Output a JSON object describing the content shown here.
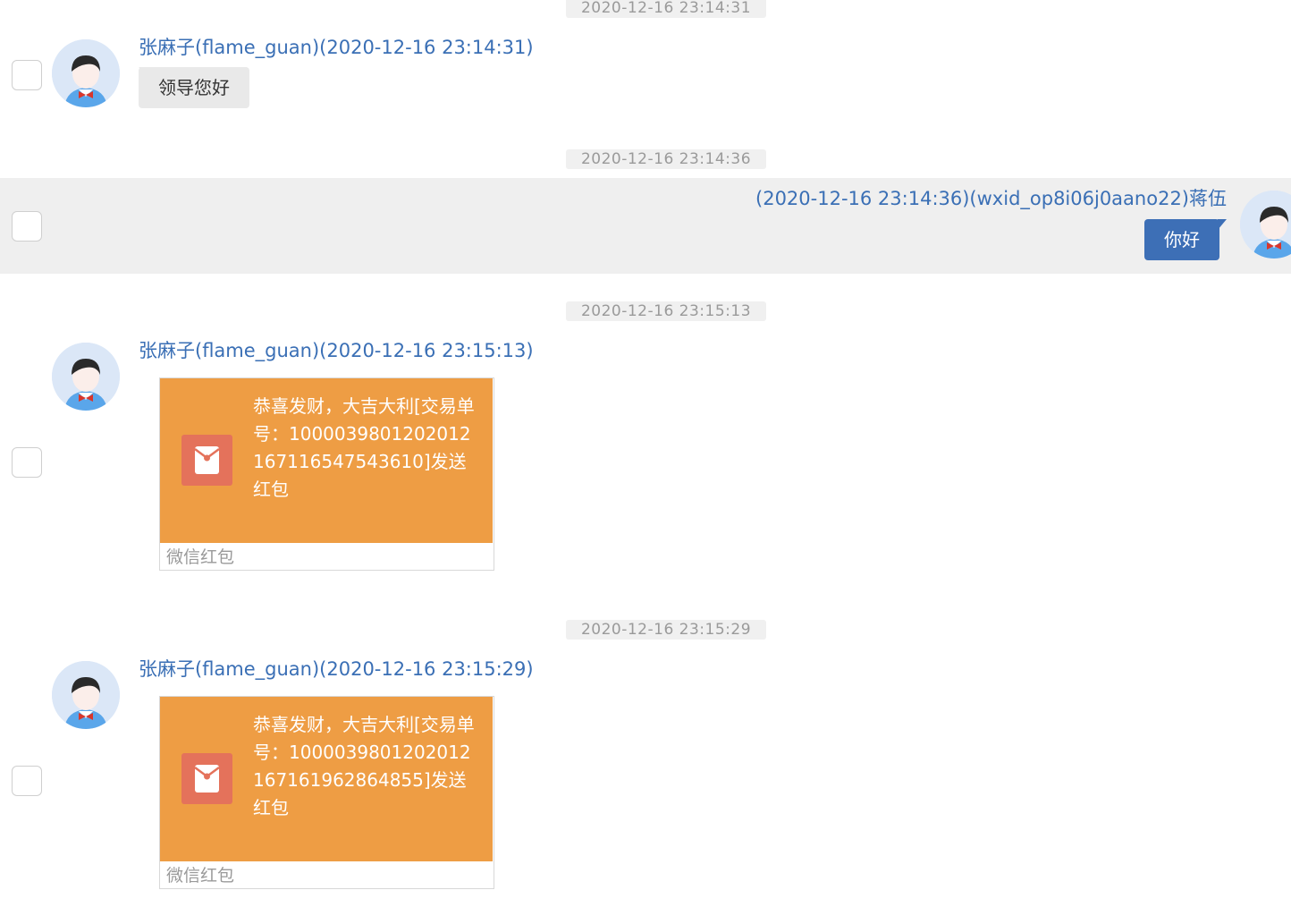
{
  "messages": [
    {
      "timestamp": "2020-12-16 23:14:31",
      "sender": "张麻子(flame_guan)(2020-12-16 23:14:31)",
      "text": "领导您好"
    },
    {
      "timestamp": "2020-12-16 23:14:36",
      "sender": "(2020-12-16 23:14:36)(wxid_op8i06j0aano22)蒋伍",
      "text": "你好"
    },
    {
      "timestamp": "2020-12-16 23:15:13",
      "sender": "张麻子(flame_guan)(2020-12-16 23:15:13)",
      "text": "恭喜发财，大吉大利[交易单号：1000039801202012167116547543610]发送红包",
      "footer": "微信红包"
    },
    {
      "timestamp": "2020-12-16 23:15:29",
      "sender": "张麻子(flame_guan)(2020-12-16 23:15:29)",
      "text": "恭喜发财，大吉大利[交易单号：1000039801202012167161962864855]发送红包",
      "footer": "微信红包"
    }
  ],
  "colors": {
    "sender_link": "#3a6fb5",
    "outgoing_bubble": "#3d6fb6",
    "incoming_bubble": "#e9e9e9",
    "red_packet": "#ee9d44",
    "red_packet_icon": "#e4725b",
    "selected_row": "#efefef"
  },
  "icons": {
    "avatar": "avatar-icon",
    "red_packet": "red-packet-icon"
  }
}
